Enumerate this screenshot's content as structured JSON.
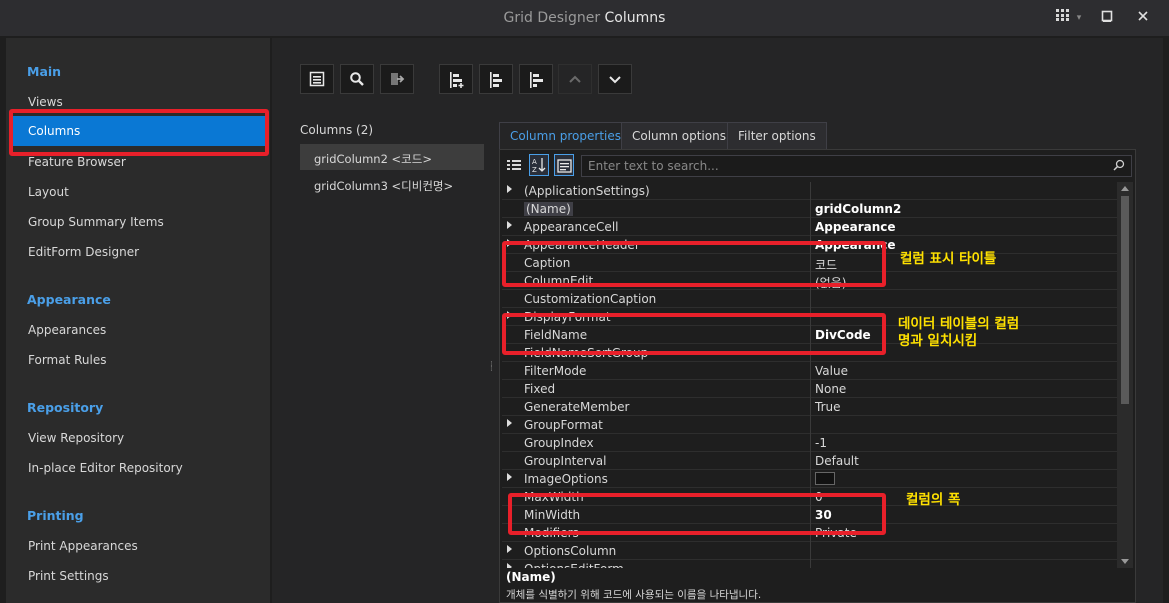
{
  "window": {
    "title_part1": "Grid Designer",
    "title_part2": "Columns"
  },
  "sidebar": {
    "groups": [
      {
        "label": "Main",
        "items": [
          "Views",
          "Columns",
          "Feature Browser",
          "Layout",
          "Group Summary Items",
          "EditForm Designer"
        ]
      },
      {
        "label": "Appearance",
        "items": [
          "Appearances",
          "Format Rules"
        ]
      },
      {
        "label": "Repository",
        "items": [
          "View Repository",
          "In-place Editor Repository"
        ]
      },
      {
        "label": "Printing",
        "items": [
          "Print Appearances",
          "Print Settings"
        ]
      }
    ],
    "g0": {
      "label": "Main",
      "i0": "Views",
      "i1": "Columns",
      "i2": "Feature Browser",
      "i3": "Layout",
      "i4": "Group Summary Items",
      "i5": "EditForm Designer"
    },
    "g1": {
      "label": "Appearance",
      "i0": "Appearances",
      "i1": "Format Rules"
    },
    "g2": {
      "label": "Repository",
      "i0": "View Repository",
      "i1": "In-place Editor Repository"
    },
    "g3": {
      "label": "Printing",
      "i0": "Print Appearances",
      "i1": "Print Settings"
    },
    "selected": "Columns"
  },
  "toolbar": {
    "icons": [
      "show-list-icon",
      "search-icon",
      "retrieve-fields-icon",
      "add-column-icon",
      "insert-column-icon",
      "remove-column-icon",
      "move-up-icon",
      "move-down-icon"
    ]
  },
  "columns_panel": {
    "title": "Columns (2)",
    "items": [
      "gridColumn2 <코드>",
      "gridColumn3 <디비컨명>"
    ],
    "selected_index": 0
  },
  "tabs": [
    "Column properties",
    "Column options",
    "Filter options"
  ],
  "tab_labels": {
    "t0": "Column properties",
    "t1": "Column options",
    "t2": "Filter options"
  },
  "active_tab": "Column properties",
  "search": {
    "placeholder": "Enter text to search..."
  },
  "properties": [
    {
      "name": "(ApplicationSettings)",
      "value": "",
      "expandable": true
    },
    {
      "name": "(Name)",
      "value": "gridColumn2",
      "bold": true,
      "selected": true
    },
    {
      "name": "AppearanceCell",
      "value": "Appearance",
      "expandable": true,
      "bold": true
    },
    {
      "name": "AppearanceHeader",
      "value": "Appearance",
      "expandable": true,
      "bold": true
    },
    {
      "name": "Caption",
      "value": "코드"
    },
    {
      "name": "ColumnEdit",
      "value": "(없음)"
    },
    {
      "name": "CustomizationCaption",
      "value": ""
    },
    {
      "name": "DisplayFormat",
      "value": "",
      "expandable": true
    },
    {
      "name": "FieldName",
      "value": "DivCode",
      "bold": true
    },
    {
      "name": "FieldNameSortGroup",
      "value": ""
    },
    {
      "name": "FilterMode",
      "value": "Value"
    },
    {
      "name": "Fixed",
      "value": "None"
    },
    {
      "name": "GenerateMember",
      "value": "True"
    },
    {
      "name": "GroupFormat",
      "value": "",
      "expandable": true
    },
    {
      "name": "GroupIndex",
      "value": "-1"
    },
    {
      "name": "GroupInterval",
      "value": "Default"
    },
    {
      "name": "ImageOptions",
      "value": "",
      "expandable": true,
      "swatch": true
    },
    {
      "name": "MaxWidth",
      "value": "0"
    },
    {
      "name": "MinWidth",
      "value": "30",
      "bold": true
    },
    {
      "name": "Modifiers",
      "value": "Private"
    },
    {
      "name": "OptionsColumn",
      "value": "",
      "expandable": true
    },
    {
      "name": "OptionsEditForm",
      "value": "",
      "expandable": true
    }
  ],
  "description": {
    "title": "(Name)",
    "text": "개체를 식별하기 위해 코드에 사용되는 이름을 나타냅니다."
  },
  "annotations": {
    "caption": "컬럼 표시 타이틀",
    "fieldname_line1": "데이터 테이블의 컬럼",
    "fieldname_line2": "명과 일치시킴",
    "minwidth": "컬럼의 폭"
  },
  "colors": {
    "accent": "#0a78d4",
    "group_heading": "#4a9fe8",
    "highlight_box": "#e8202a",
    "annotation_text": "#ffe100"
  }
}
